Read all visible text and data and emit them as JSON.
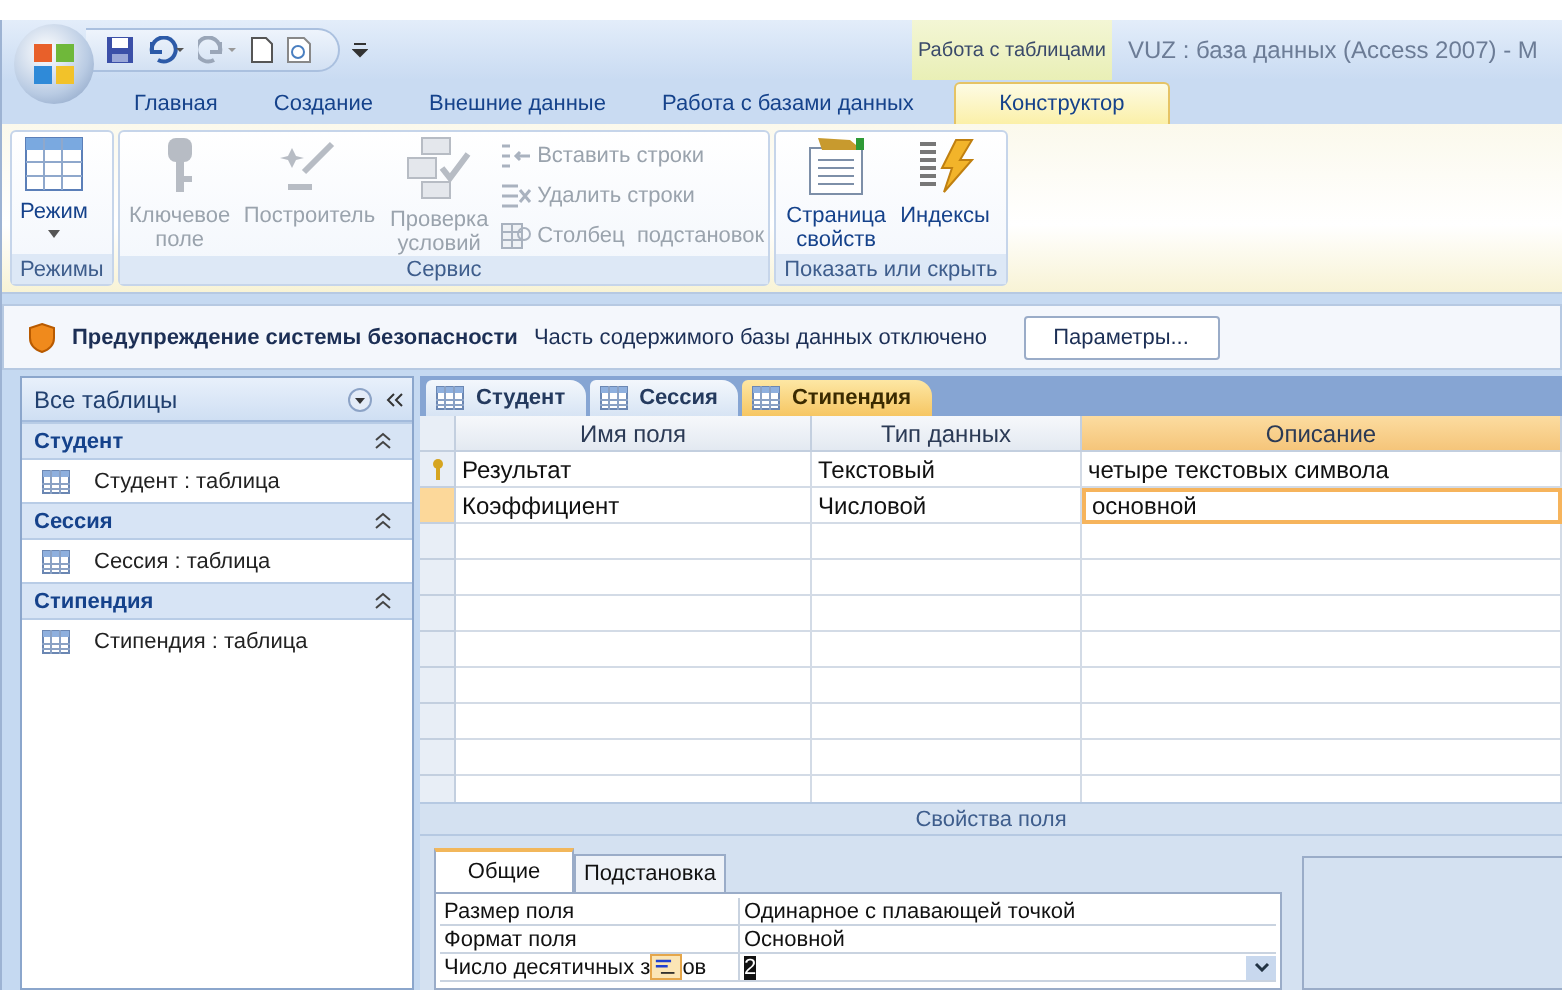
{
  "window": {
    "title": "VUZ : база данных (Access 2007)  - M",
    "context_group": "Работа с таблицами"
  },
  "ribbon_tabs": [
    {
      "label": "Главная",
      "selected": false
    },
    {
      "label": "Создание",
      "selected": false
    },
    {
      "label": "Внешние данные",
      "selected": false
    },
    {
      "label": "Работа с базами данных",
      "selected": false
    },
    {
      "label": "Конструктор",
      "selected": true
    }
  ],
  "ribbon_groups": [
    {
      "title": "Режимы",
      "buttons": [
        {
          "kind": "large",
          "label": "Режим",
          "disabled": false
        }
      ]
    },
    {
      "title": "Сервис",
      "buttons": [
        {
          "kind": "large",
          "label": "Ключевое поле",
          "disabled": true
        },
        {
          "kind": "large",
          "label": "Построитель",
          "disabled": true
        },
        {
          "kind": "large",
          "label": "Проверка условий",
          "disabled": true
        },
        {
          "kind": "small",
          "label": "Вставить строки",
          "disabled": true
        },
        {
          "kind": "small",
          "label": "Удалить строки",
          "disabled": true
        },
        {
          "kind": "small",
          "label": "Столбец  подстановок",
          "disabled": true
        }
      ]
    },
    {
      "title": "Показать или скрыть",
      "buttons": [
        {
          "kind": "large",
          "label": "Страница свойств",
          "disabled": false
        },
        {
          "kind": "large",
          "label": "Индексы",
          "disabled": false
        }
      ]
    }
  ],
  "security_bar": {
    "title": "Предупреждение системы безопасности",
    "message": "Часть содержимого базы данных отключено",
    "button": "Параметры..."
  },
  "nav_pane": {
    "header": "Все таблицы",
    "groups": [
      {
        "title": "Студент",
        "expanded": true,
        "items": [
          "Студент : таблица"
        ]
      },
      {
        "title": "Сессия",
        "expanded": true,
        "items": [
          "Сессия : таблица"
        ]
      },
      {
        "title": "Стипендия",
        "expanded": true,
        "items": [
          "Стипендия : таблица"
        ]
      }
    ]
  },
  "doc_tabs": [
    {
      "label": "Студент",
      "selected": false
    },
    {
      "label": "Сессия",
      "selected": false
    },
    {
      "label": "Стипендия",
      "selected": true
    }
  ],
  "grid": {
    "columns": [
      "Имя поля",
      "Тип данных",
      "Описание"
    ],
    "rows": [
      {
        "name": "Результат",
        "type": "Текстовый",
        "description": "четыре текстовых символа",
        "primary_key": true,
        "current": false
      },
      {
        "name": "Коэффициент",
        "type": "Числовой",
        "description": "основной",
        "primary_key": false,
        "current": true
      }
    ]
  },
  "field_properties": {
    "title": "Свойства поля",
    "tabs": [
      {
        "label": "Общие",
        "selected": true
      },
      {
        "label": "Подстановка",
        "selected": false
      }
    ],
    "rows": [
      {
        "label": "Размер поля",
        "value": "Одинарное с плавающей точкой",
        "selected": false
      },
      {
        "label": "Формат поля",
        "value": "Основной",
        "selected": false
      },
      {
        "label": "Число десятичных з",
        "label_tail": "ов",
        "value": "2",
        "selected": true
      }
    ]
  }
}
